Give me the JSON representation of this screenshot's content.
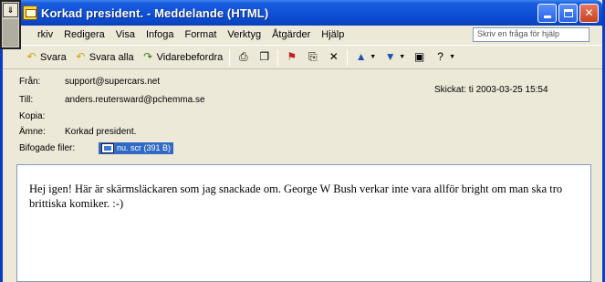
{
  "window": {
    "title": "Korkad president. - Meddelande (HTML)"
  },
  "menu": {
    "items": [
      "rkiv",
      "Redigera",
      "Visa",
      "Infoga",
      "Format",
      "Verktyg",
      "Åtgärder",
      "Hjälp"
    ],
    "help_placeholder": "Skriv en fråga för hjälp"
  },
  "toolbar": {
    "reply_label": "Svara",
    "reply_all_label": "Svara alla",
    "forward_label": "Vidarebefordra"
  },
  "headers": {
    "from_label": "Från:",
    "from_value": "support@supercars.net",
    "to_label": "Till:",
    "to_value": "anders.reutersward@pchemma.se",
    "cc_label": "Kopia:",
    "cc_value": "",
    "subject_label": "Ämne:",
    "subject_value": "Korkad president.",
    "attachments_label": "Bifogade filer:",
    "attachment_name": "nu. scr (391 B)",
    "sent_label": "Skickat:",
    "sent_value": "ti 2003-03-25 15:54"
  },
  "body": {
    "text": "Hej igen! Här är skärmsläckaren som jag snackade om. George W Bush verkar inte vara allför bright om man ska tro brittiska komiker. :-)"
  },
  "colors": {
    "titlebar": "#0f4fd6",
    "attachment_highlight": "#316ac5",
    "close_button": "#c8421e"
  }
}
